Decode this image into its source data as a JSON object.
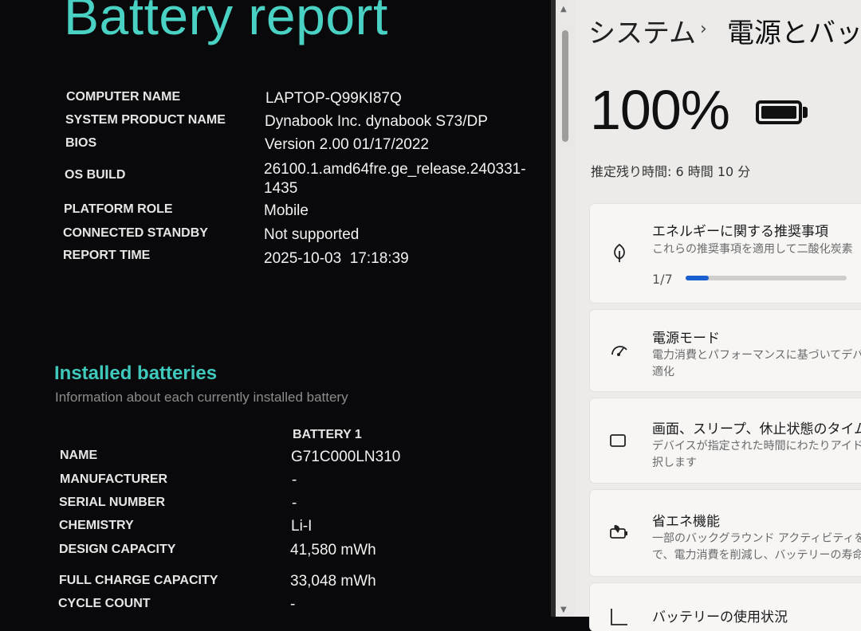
{
  "report": {
    "title": "Battery report",
    "fields": [
      {
        "label": "COMPUTER NAME",
        "value": "LAPTOP-Q99KI87Q"
      },
      {
        "label": "SYSTEM PRODUCT NAME",
        "value": "Dynabook Inc. dynabook S73/DP"
      },
      {
        "label": "BIOS",
        "value": "Version 2.00 01/17/2022"
      },
      {
        "label": "OS BUILD",
        "value_line1": "26100.1.amd64fre.ge_release.240331-",
        "value_line2": "1435"
      },
      {
        "label": "PLATFORM ROLE",
        "value": "Mobile"
      },
      {
        "label": "CONNECTED STANDBY",
        "value": "Not supported"
      },
      {
        "label": "REPORT TIME",
        "value": "2025-10-03  17:18:39"
      }
    ],
    "installed": {
      "heading": "Installed batteries",
      "subheading": "Information about each currently installed battery",
      "column": "BATTERY 1",
      "rows": [
        {
          "label": "NAME",
          "value": "G71C000LN310"
        },
        {
          "label": "MANUFACTURER",
          "value": "-"
        },
        {
          "label": "SERIAL NUMBER",
          "value": "-"
        },
        {
          "label": "CHEMISTRY",
          "value": "Li-I"
        },
        {
          "label": "DESIGN CAPACITY",
          "value": "41,580 mWh"
        },
        {
          "label": "FULL CHARGE CAPACITY",
          "value": "33,048 mWh"
        },
        {
          "label": "CYCLE COUNT",
          "value": "-"
        }
      ]
    }
  },
  "settings": {
    "breadcrumb_root": "システム",
    "breadcrumb_sep": "›",
    "breadcrumb_current": "電源とバッテ",
    "battery_percent": "100%",
    "battery_level_fraction": 1.0,
    "remaining": "推定残り時間: 6 時間 10 分",
    "cards": [
      {
        "title": "エネルギーに関する推奨事項",
        "desc1": "これらの推奨事項を適用して二酸化炭素",
        "progress_label": "1/7",
        "progress_fraction": 0.143,
        "icon": "leaf-icon"
      },
      {
        "title": "電源モード",
        "desc1": "電力消費とパフォーマンスに基づいてデバイ",
        "desc2": "適化",
        "icon": "power-mode-icon"
      },
      {
        "title": "画面、スリープ、休止状態のタイムア",
        "desc1": "デバイスが指定された時間にわたりアイドル",
        "desc2": "択します",
        "icon": "screen-sleep-icon"
      },
      {
        "title": "省エネ機能",
        "desc1": "一部のバックグラウンド アクティビティを制限",
        "desc2": "で、電力消費を削減し、バッテリーの寿命を",
        "icon": "energy-saver-icon"
      },
      {
        "title": "バッテリーの使用状況",
        "icon": "battery-usage-icon"
      }
    ],
    "accent_color": "#1a5fcf",
    "report_heading_color": "#49d1c4"
  }
}
